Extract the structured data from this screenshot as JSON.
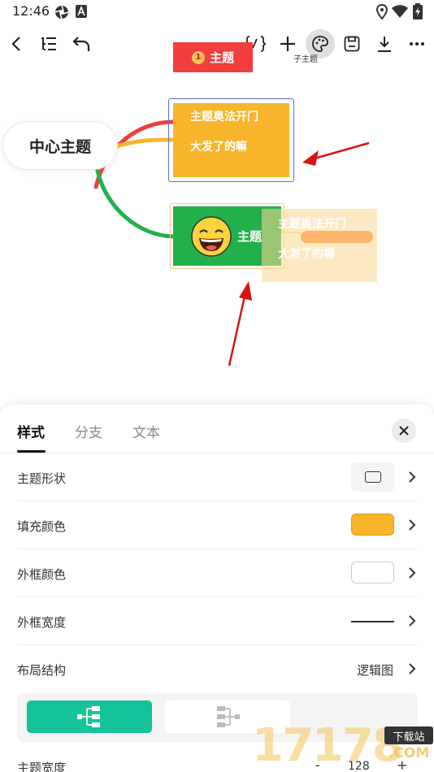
{
  "status_bar": {
    "time": "12:46"
  },
  "canvas": {
    "center_topic": "中心主题",
    "red_topic": {
      "badge": "1",
      "label": "主题"
    },
    "sub_topic_label": "子主题",
    "yellow_topic": {
      "line1": "主题奥法开门",
      "line2": "大发了的嘛"
    },
    "green_topic": {
      "label": "主题"
    },
    "ghost_topic": {
      "line1": "主题奥法开门",
      "line2": "大发了的嘛"
    },
    "branch_colors": {
      "red": "#f23e3e",
      "yellow": "#f7b52c",
      "green": "#22b04b"
    }
  },
  "toolbar": {
    "icons": [
      "back-icon",
      "outline-icon",
      "undo-icon",
      "formula-icon",
      "add-icon",
      "palette-icon",
      "save-icon",
      "download-icon",
      "more-icon"
    ]
  },
  "sheet": {
    "tabs": [
      {
        "label": "样式",
        "active": true
      },
      {
        "label": "分支",
        "active": false
      },
      {
        "label": "文本",
        "active": false
      }
    ],
    "rows": {
      "shape": {
        "label": "主题形状"
      },
      "fill": {
        "label": "填充颜色",
        "color": "#f7b52c"
      },
      "border_color": {
        "label": "外框颜色",
        "color": "#ffffff"
      },
      "border_width": {
        "label": "外框宽度"
      },
      "layout": {
        "label": "布局结构",
        "value": "逻辑图"
      }
    },
    "layout_options": [
      {
        "name": "logic-right",
        "active": true
      },
      {
        "name": "logic-left",
        "active": false
      }
    ],
    "topic_width": {
      "label": "主题宽度",
      "minus": "-",
      "value": "128",
      "plus": "+"
    },
    "accent_color": "#14c39a"
  },
  "watermark": {
    "digits": "17178",
    "tag": "下载站",
    "domain": ".COM"
  }
}
